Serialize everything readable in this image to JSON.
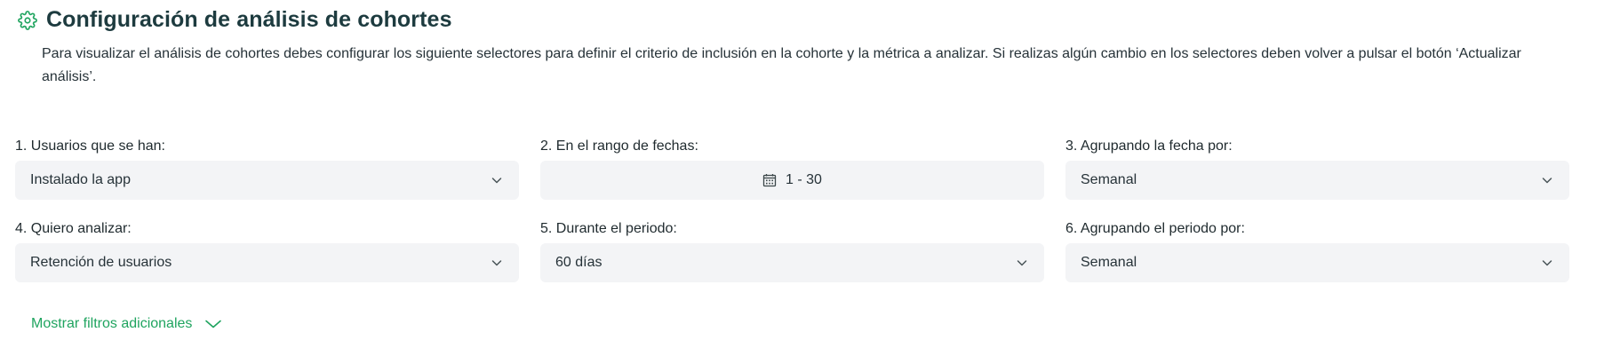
{
  "header": {
    "title": "Configuración de análisis de cohortes",
    "icon": "gear-icon",
    "accent_color": "#1fa45f"
  },
  "description": "Para visualizar el análisis de cohortes debes configurar los siguiente selectores para definir el criterio de inclusión en la cohorte y la métrica a analizar. Si realizas algún cambio en los selectores deben volver a pulsar el botón ‘Actualizar análisis’.",
  "fields": [
    {
      "label": "1. Usuarios que se han:",
      "value": "Instalado la app",
      "icon": "chevron-down-icon"
    },
    {
      "label": "2. En el rango de fechas:",
      "value": "1 - 30",
      "icon": "calendar-icon"
    },
    {
      "label": "3. Agrupando la fecha por:",
      "value": "Semanal",
      "icon": "chevron-down-icon"
    },
    {
      "label": "4. Quiero analizar:",
      "value": "Retención de usuarios",
      "icon": "chevron-down-icon"
    },
    {
      "label": "5. Durante el periodo:",
      "value": "60 días",
      "icon": "chevron-down-icon"
    },
    {
      "label": "6. Agrupando el periodo por:",
      "value": "Semanal",
      "icon": "chevron-down-icon"
    }
  ],
  "more_filters": {
    "label": "Mostrar filtros adicionales",
    "icon": "chevron-down-icon",
    "color": "#1fa45f"
  }
}
